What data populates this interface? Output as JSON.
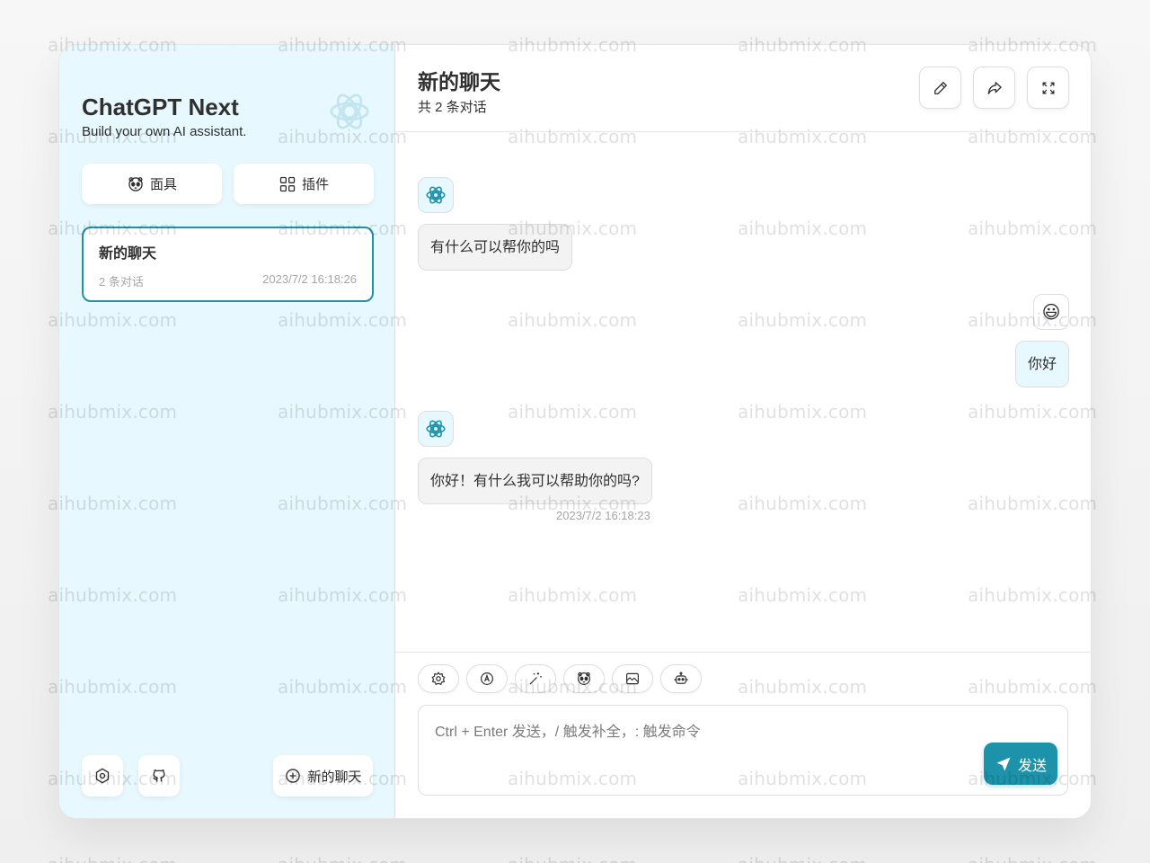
{
  "watermark": "aihubmix.com",
  "sidebar": {
    "brand_title": "ChatGPT Next",
    "brand_subtitle": "Build your own AI assistant.",
    "masks_label": "面具",
    "plugins_label": "插件",
    "new_chat_label": "新的聊天",
    "chats": [
      {
        "title": "新的聊天",
        "count": "2 条对话",
        "time": "2023/7/2 16:18:26",
        "selected": true
      }
    ]
  },
  "header": {
    "title": "新的聊天",
    "subtitle": "共 2 条对话",
    "buttons": [
      "edit-icon",
      "share-icon",
      "fullscreen-icon"
    ]
  },
  "messages": [
    {
      "role": "assistant",
      "text": "有什么可以帮你的吗",
      "avatar": "openai-logo-icon"
    },
    {
      "role": "user",
      "text": "你好",
      "avatar": "😃"
    },
    {
      "role": "assistant",
      "text": "你好！有什么我可以帮助你的吗?",
      "time": "2023/7/2 16:18:23",
      "avatar": "openai-logo-icon"
    }
  ],
  "input": {
    "placeholder": "Ctrl + Enter 发送，/ 触发补全，: 触发命令",
    "value": "",
    "send_label": "发送",
    "tools": [
      "settings-icon",
      "theme-auto-icon",
      "prompt-magic-icon",
      "mask-icon",
      "image-icon",
      "robot-icon"
    ]
  },
  "colors": {
    "accent": "#1d93ab",
    "sidebar_bg": "#e7f8ff",
    "bot_bubble": "#f3f3f3",
    "user_bubble": "#e7f8ff"
  }
}
